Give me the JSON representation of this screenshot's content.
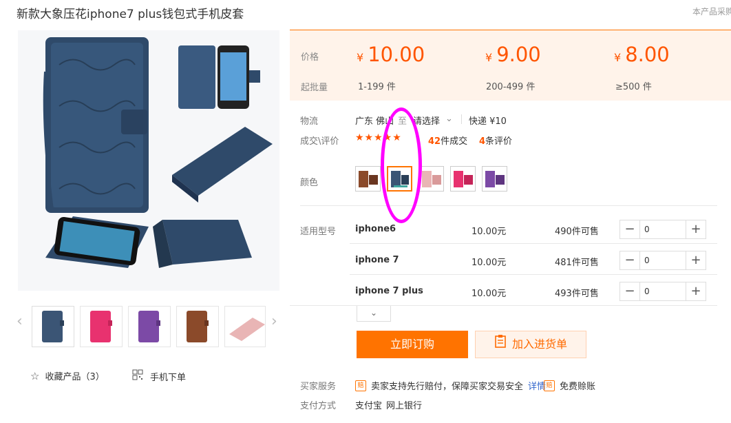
{
  "header": {
    "title": "新款大象压花iphone7 plus钱包式手机皮套",
    "report": "本产品采购"
  },
  "gallery": {
    "prev_icon": "‹",
    "next_icon": "›",
    "thumbs": [
      {
        "color": "#3b5575",
        "name": "navy"
      },
      {
        "color": "#e8326f",
        "name": "rose"
      },
      {
        "color": "#7c4aa6",
        "name": "purple"
      },
      {
        "color": "#8b4a2a",
        "name": "brown"
      },
      {
        "color": "#e9b5b5",
        "name": "pink"
      }
    ]
  },
  "actions": {
    "favorite_label": "收藏产品（3）",
    "mobile_label": "手机下单"
  },
  "pricing": {
    "price_label": "价格",
    "moq_label": "起批量",
    "currency": "¥",
    "tiers": [
      {
        "price": "10.00",
        "range": "1-199 件"
      },
      {
        "price": "9.00",
        "range": "200-499 件"
      },
      {
        "price": "8.00",
        "range": "≥500 件"
      }
    ]
  },
  "logistics": {
    "label": "物流",
    "origin": "广东 佛山",
    "to": "至",
    "select": "请选择",
    "shipping": "快递 ¥10"
  },
  "deals": {
    "label": "成交\\评价",
    "stars": "★★★★★",
    "rating": 5,
    "deal_count": "42",
    "deal_suffix": "件成交",
    "review_count": "4",
    "review_suffix": "条评价"
  },
  "color": {
    "label": "颜色",
    "selected_index": 1,
    "swatches": [
      {
        "color": "#8b4a2a"
      },
      {
        "color": "#3b5575"
      },
      {
        "color": "#e9b5b5"
      },
      {
        "color": "#e8326f"
      },
      {
        "color": "#7c4aa6"
      }
    ]
  },
  "models": {
    "label": "适用型号",
    "rows": [
      {
        "name": "iphone6",
        "price": "10.00元",
        "stock": "490件可售",
        "qty": "0"
      },
      {
        "name": "iphone 7",
        "price": "10.00元",
        "stock": "481件可售",
        "qty": "0"
      },
      {
        "name": "iphone 7 plus",
        "price": "10.00元",
        "stock": "493件可售",
        "qty": "0"
      }
    ]
  },
  "buttons": {
    "buy": "立即订购",
    "cart": "加入进货单"
  },
  "service": {
    "label": "买家服务",
    "badge1": "赔",
    "text1": "卖家支持先行赔付，保障买家交易安全",
    "detail": "详情",
    "badge2": "赔",
    "text2": "免费赊账"
  },
  "payment": {
    "label": "支付方式",
    "methods": [
      "支付宝",
      "网上银行"
    ]
  },
  "annotation": {
    "color": "#ff00ff"
  }
}
